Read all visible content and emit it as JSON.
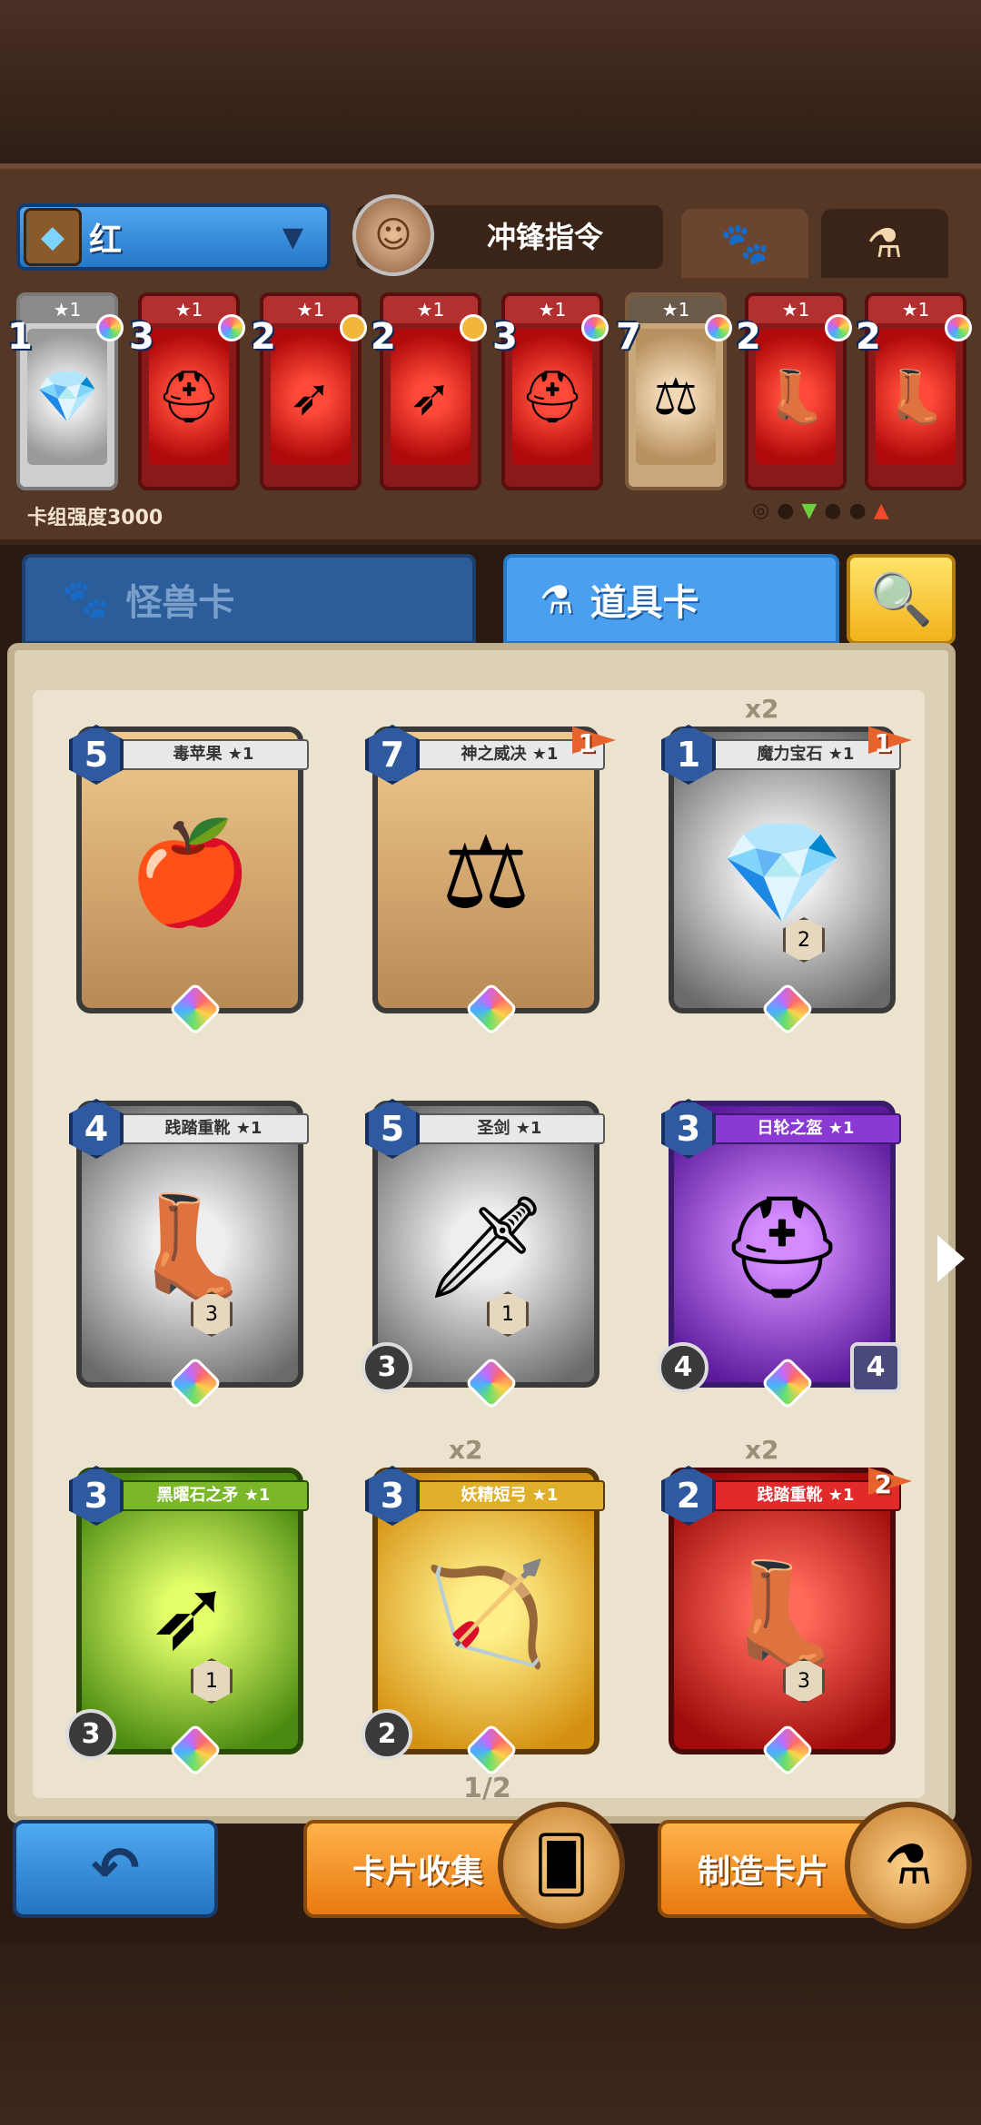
{
  "header": {
    "deck_name": "红",
    "hero_name": "冲锋指令",
    "tab_monster_icon": "paw-icon",
    "tab_item_icon": "potion-icon"
  },
  "deck": {
    "cards": [
      {
        "stars": "★1",
        "cost": "1",
        "gem": "rainbow",
        "frame": "gray",
        "icon": "blue-crystal-icon"
      },
      {
        "stars": "★1",
        "cost": "3",
        "gem": "rainbow",
        "frame": "red",
        "icon": "helmet-icon"
      },
      {
        "stars": "★1",
        "cost": "2",
        "gem": "gold",
        "frame": "red",
        "icon": "spear-icon"
      },
      {
        "stars": "★1",
        "cost": "2",
        "gem": "gold",
        "frame": "red",
        "icon": "spear-icon"
      },
      {
        "stars": "★1",
        "cost": "3",
        "gem": "rainbow",
        "frame": "red",
        "icon": "helmet-icon"
      },
      {
        "stars": "★1",
        "cost": "7",
        "gem": "rainbow",
        "frame": "tan",
        "icon": "scales-icon"
      },
      {
        "stars": "★1",
        "cost": "2",
        "gem": "rainbow",
        "frame": "red",
        "icon": "boots-icon"
      },
      {
        "stars": "★1",
        "cost": "2",
        "gem": "rainbow",
        "frame": "red",
        "icon": "boots-icon"
      }
    ],
    "strength_label": "卡组强度3000"
  },
  "tabs": {
    "monster": "怪兽卡",
    "item": "道具卡"
  },
  "cards": [
    {
      "cost": "5",
      "name": "毒苹果 ★1",
      "icon": "poison-apple-icon",
      "frame": "tan"
    },
    {
      "cost": "7",
      "name": "神之威决 ★1",
      "icon": "scales-icon",
      "frame": "tan",
      "flag": "1"
    },
    {
      "cost": "1",
      "name": "魔力宝石 ★1",
      "icon": "blue-crystal-icon",
      "frame": "gray",
      "flag": "1",
      "count": "x2",
      "mini": "2"
    },
    {
      "cost": "4",
      "name": "践踏重靴 ★1",
      "icon": "boots-icon",
      "frame": "gray",
      "mini": "3"
    },
    {
      "cost": "5",
      "name": "圣剑 ★1",
      "icon": "sword-icon",
      "frame": "gray",
      "stat_l": "3",
      "mini": "1"
    },
    {
      "cost": "3",
      "name": "日轮之盔 ★1",
      "icon": "helmet-icon",
      "frame": "purple",
      "stat_l": "4",
      "stat_r": "4"
    },
    {
      "cost": "3",
      "name": "黑曜石之矛 ★1",
      "icon": "spear-icon",
      "frame": "green",
      "stat_l": "3",
      "mini": "1"
    },
    {
      "cost": "3",
      "name": "妖精短弓 ★1",
      "icon": "bow-icon",
      "frame": "yellow",
      "stat_l": "2",
      "count": "x2"
    },
    {
      "cost": "2",
      "name": "践踏重靴 ★1",
      "icon": "boots-icon",
      "frame": "red",
      "flag": "2",
      "count": "x2",
      "mini": "3"
    }
  ],
  "page_indicator": "1/2",
  "buttons": {
    "back": "↶",
    "collect": "卡片收集",
    "craft": "制造卡片"
  }
}
